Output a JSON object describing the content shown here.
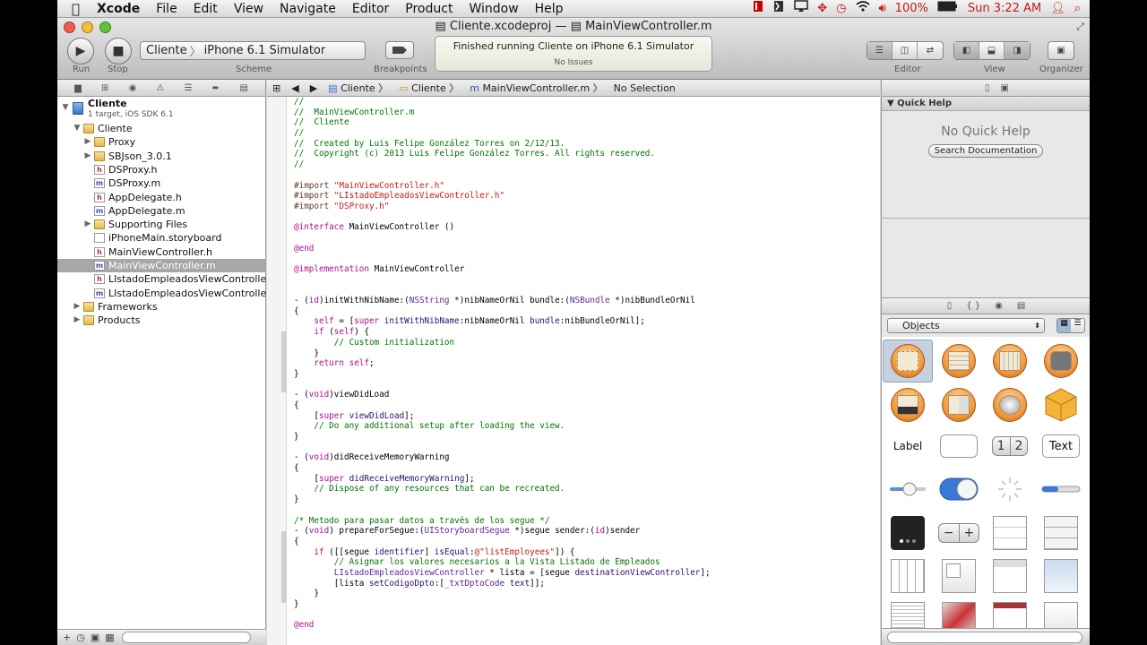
{
  "menubar": {
    "apple": "",
    "app": "Xcode",
    "items": [
      "File",
      "Edit",
      "View",
      "Navigate",
      "Editor",
      "Product",
      "Window",
      "Help"
    ],
    "battery": "100%",
    "clock": "Sun 3:22 AM"
  },
  "window": {
    "title_project": "Cliente.xcodeproj",
    "title_sep": "—",
    "title_file": "MainViewController.m"
  },
  "toolbar": {
    "run_label": "Run",
    "stop_label": "Stop",
    "scheme_target": "Cliente",
    "scheme_sep": "〉",
    "scheme_dest": "iPhone 6.1 Simulator",
    "scheme_label": "Scheme",
    "breakpoints_label": "Breakpoints",
    "activity_status": "Finished running Cliente on iPhone 6.1 Simulator",
    "activity_issues": "No Issues",
    "editor_label": "Editor",
    "view_label": "View",
    "organizer_label": "Organizer"
  },
  "navigator": {
    "project_name": "Cliente",
    "project_sub": "1 target, iOS SDK 6.1",
    "items": [
      {
        "label": "Cliente",
        "kind": "folder",
        "level": 1,
        "open": true
      },
      {
        "label": "Proxy",
        "kind": "folder",
        "level": 2,
        "open": false
      },
      {
        "label": "SBJson_3.0.1",
        "kind": "folder",
        "level": 2,
        "open": false
      },
      {
        "label": "DSProxy.h",
        "kind": "h",
        "level": 2
      },
      {
        "label": "DSProxy.m",
        "kind": "m",
        "level": 2
      },
      {
        "label": "AppDelegate.h",
        "kind": "h",
        "level": 2
      },
      {
        "label": "AppDelegate.m",
        "kind": "m",
        "level": 2
      },
      {
        "label": "Supporting Files",
        "kind": "folder",
        "level": 2,
        "open": false
      },
      {
        "label": "iPhoneMain.storyboard",
        "kind": "sb",
        "level": 2
      },
      {
        "label": "MainViewController.h",
        "kind": "h",
        "level": 2
      },
      {
        "label": "MainViewController.m",
        "kind": "m",
        "level": 2,
        "selected": true
      },
      {
        "label": "LIstadoEmpleadosViewController.h",
        "kind": "h",
        "level": 2
      },
      {
        "label": "LIstadoEmpleadosViewController.m",
        "kind": "m",
        "level": 2
      },
      {
        "label": "Frameworks",
        "kind": "folder",
        "level": 1,
        "open": false
      },
      {
        "label": "Products",
        "kind": "folder",
        "level": 1,
        "open": false
      }
    ]
  },
  "jumpbar": {
    "items": [
      "Cliente",
      "Cliente",
      "MainViewController.m",
      "No Selection"
    ]
  },
  "code_lines": [
    [
      [
        "cm",
        "//"
      ]
    ],
    [
      [
        "cm",
        "//  MainViewController.m"
      ]
    ],
    [
      [
        "cm",
        "//  Cliente"
      ]
    ],
    [
      [
        "cm",
        "//"
      ]
    ],
    [
      [
        "cm",
        "//  Created by Luis Felipe González Torres on 2/12/13."
      ]
    ],
    [
      [
        "cm",
        "//  Copyright (c) 2013 Luis Felipe González Torres. All rights reserved."
      ]
    ],
    [
      [
        "cm",
        "//"
      ]
    ],
    [
      [
        "",
        ""
      ]
    ],
    [
      [
        "pp",
        "#import "
      ],
      [
        "st",
        "\"MainViewController.h\""
      ]
    ],
    [
      [
        "pp",
        "#import "
      ],
      [
        "st",
        "\"LIstadoEmpleadosViewController.h\""
      ]
    ],
    [
      [
        "pp",
        "#import "
      ],
      [
        "st",
        "\"DSProxy.h\""
      ]
    ],
    [
      [
        "",
        ""
      ]
    ],
    [
      [
        "kw",
        "@interface"
      ],
      [
        "",
        " MainViewController ()"
      ]
    ],
    [
      [
        "",
        ""
      ]
    ],
    [
      [
        "kw",
        "@end"
      ]
    ],
    [
      [
        "",
        ""
      ]
    ],
    [
      [
        "kw",
        "@implementation"
      ],
      [
        "",
        " MainViewController"
      ]
    ],
    [
      [
        "",
        ""
      ]
    ],
    [
      [
        "",
        ""
      ]
    ],
    [
      [
        "",
        "- ("
      ],
      [
        "kw",
        "id"
      ],
      [
        "",
        ")initWithNibName:("
      ],
      [
        "ty",
        "NSString"
      ],
      [
        "",
        " *)nibNameOrNil bundle:("
      ],
      [
        "ty",
        "NSBundle"
      ],
      [
        "",
        " *)nibBundleOrNil"
      ]
    ],
    [
      [
        "",
        "{"
      ]
    ],
    [
      [
        "",
        "    "
      ],
      [
        "kw",
        "self"
      ],
      [
        "",
        " = ["
      ],
      [
        "kw",
        "super"
      ],
      [
        "fn",
        " initWithNibName"
      ],
      [
        "",
        ":nibNameOrNil "
      ],
      [
        "fn",
        "bundle"
      ],
      [
        "",
        ":nibBundleOrNil];"
      ]
    ],
    [
      [
        "",
        "    "
      ],
      [
        "kw",
        "if"
      ],
      [
        "",
        " ("
      ],
      [
        "kw",
        "self"
      ],
      [
        "",
        ") {"
      ]
    ],
    [
      [
        "",
        "        "
      ],
      [
        "cm",
        "// Custom initialization"
      ]
    ],
    [
      [
        "",
        "    }"
      ]
    ],
    [
      [
        "",
        "    "
      ],
      [
        "kw",
        "return"
      ],
      [
        "",
        " "
      ],
      [
        "kw",
        "self"
      ],
      [
        "",
        ";"
      ]
    ],
    [
      [
        "",
        "}"
      ]
    ],
    [
      [
        "",
        ""
      ]
    ],
    [
      [
        "",
        "- ("
      ],
      [
        "kw",
        "void"
      ],
      [
        "",
        ")viewDidLoad"
      ]
    ],
    [
      [
        "",
        "{"
      ]
    ],
    [
      [
        "",
        "    ["
      ],
      [
        "kw",
        "super"
      ],
      [
        "fn",
        " viewDidLoad"
      ],
      [
        "",
        "];"
      ]
    ],
    [
      [
        "",
        "    "
      ],
      [
        "cm",
        "// Do any additional setup after loading the view."
      ]
    ],
    [
      [
        "",
        "}"
      ]
    ],
    [
      [
        "",
        ""
      ]
    ],
    [
      [
        "",
        "- ("
      ],
      [
        "kw",
        "void"
      ],
      [
        "",
        ")didReceiveMemoryWarning"
      ]
    ],
    [
      [
        "",
        "{"
      ]
    ],
    [
      [
        "",
        "    ["
      ],
      [
        "kw",
        "super"
      ],
      [
        "fn",
        " didReceiveMemoryWarning"
      ],
      [
        "",
        "];"
      ]
    ],
    [
      [
        "",
        "    "
      ],
      [
        "cm",
        "// Dispose of any resources that can be recreated."
      ]
    ],
    [
      [
        "",
        "}"
      ]
    ],
    [
      [
        "",
        ""
      ]
    ],
    [
      [
        "cm",
        "/* Metodo para pasar datos a través de los segue */"
      ]
    ],
    [
      [
        "",
        "- ("
      ],
      [
        "kw",
        "void"
      ],
      [
        "",
        ") prepareForSegue:("
      ],
      [
        "ty",
        "UIStoryboardSegue"
      ],
      [
        "",
        " *)segue sender:("
      ],
      [
        "kw",
        "id"
      ],
      [
        "",
        ")sender"
      ]
    ],
    [
      [
        "",
        "{"
      ]
    ],
    [
      [
        "",
        "    "
      ],
      [
        "kw",
        "if"
      ],
      [
        "",
        " ([[segue "
      ],
      [
        "fn",
        "identifier"
      ],
      [
        "",
        "] "
      ],
      [
        "fn",
        "isEqual"
      ],
      [
        "",
        ":"
      ],
      [
        "st",
        "@\"listEmployees\""
      ],
      [
        "",
        "]) {"
      ]
    ],
    [
      [
        "",
        "        "
      ],
      [
        "cm",
        "// Asignar los valores necesarios a la Vista Listado de Empleados"
      ]
    ],
    [
      [
        "",
        "        "
      ],
      [
        "ty",
        "LIstadoEmpleadosViewController"
      ],
      [
        "",
        " * lista = [segue "
      ],
      [
        "fn",
        "destinationViewController"
      ],
      [
        "",
        "];"
      ]
    ],
    [
      [
        "",
        "        [lista "
      ],
      [
        "fn",
        "setCodigoDpto"
      ],
      [
        "",
        ":["
      ],
      [
        "ty",
        "_txtDptoCode"
      ],
      [
        "",
        " "
      ],
      [
        "fn",
        "text"
      ],
      [
        "",
        "]];"
      ]
    ],
    [
      [
        "",
        "    }"
      ]
    ],
    [
      [
        "",
        "}"
      ]
    ],
    [
      [
        "",
        ""
      ]
    ],
    [
      [
        "kw",
        "@end"
      ]
    ]
  ],
  "quick_help": {
    "header": "Quick Help",
    "empty": "No Quick Help",
    "search_button": "Search Documentation"
  },
  "library": {
    "selector": "Objects",
    "label_item": "Label",
    "segment_1": "1",
    "segment_2": "2",
    "text_item": "Text"
  }
}
